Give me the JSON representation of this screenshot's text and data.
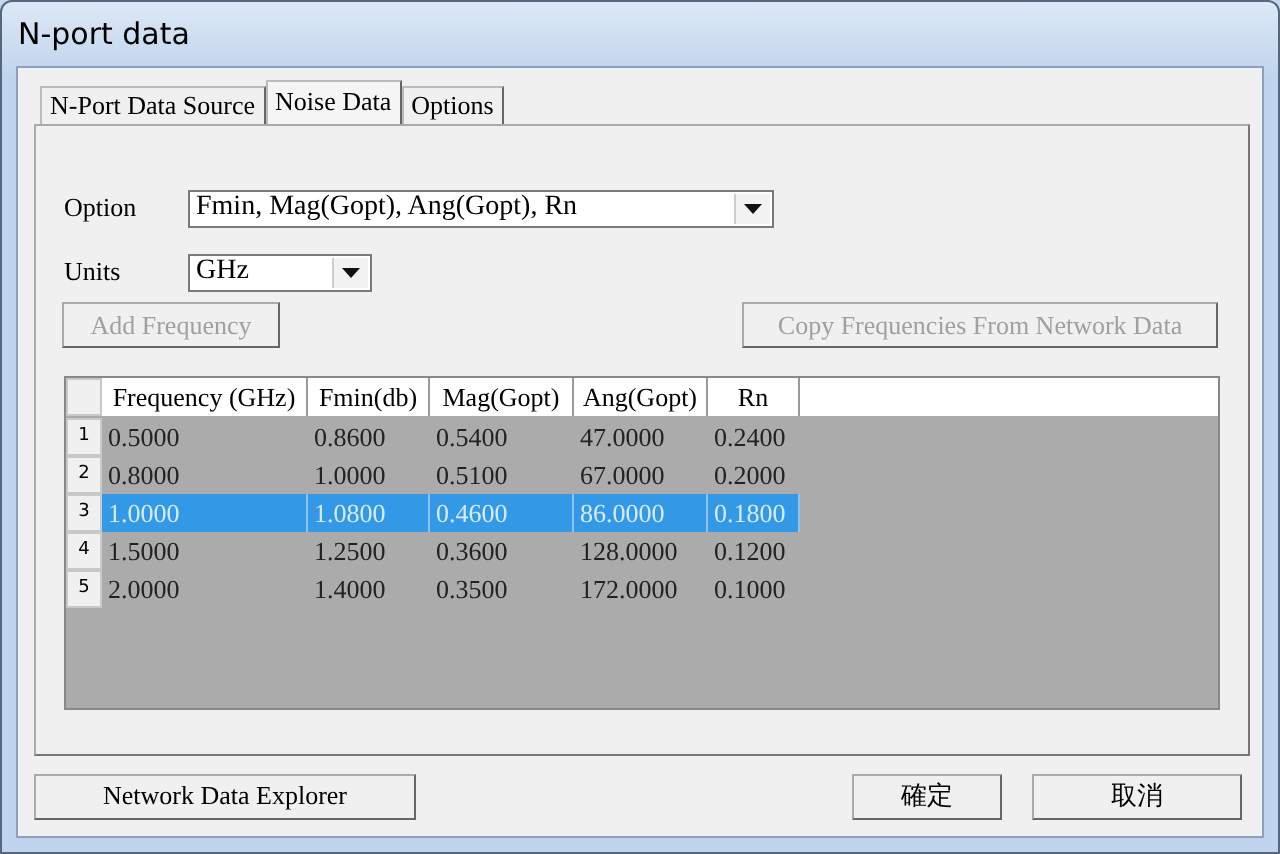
{
  "window": {
    "title": "N-port data"
  },
  "tabs": [
    {
      "label": "N-Port Data Source",
      "selected": false
    },
    {
      "label": "Noise Data",
      "selected": true
    },
    {
      "label": "Options",
      "selected": false
    }
  ],
  "option": {
    "label": "Option",
    "value": "Fmin, Mag(Gopt), Ang(Gopt), Rn"
  },
  "units": {
    "label": "Units",
    "value": "GHz"
  },
  "buttons": [
    {
      "label": "Add Frequency",
      "disabled": true
    },
    {
      "label": "Copy Frequencies From Network Data",
      "disabled": true
    }
  ],
  "table": {
    "columns": [
      "Frequency (GHz)",
      "Fmin(db)",
      "Mag(Gopt)",
      "Ang(Gopt)",
      "Rn"
    ],
    "rows": [
      {
        "number": "1",
        "cells": [
          "0.5000",
          "0.8600",
          "0.5400",
          "47.0000",
          "0.2400"
        ],
        "selected": false
      },
      {
        "number": "2",
        "cells": [
          "0.8000",
          "1.0000",
          "0.5100",
          "67.0000",
          "0.2000"
        ],
        "selected": false
      },
      {
        "number": "3",
        "cells": [
          "1.0000",
          "1.0800",
          "0.4600",
          "86.0000",
          "0.1800"
        ],
        "selected": true
      },
      {
        "number": "4",
        "cells": [
          "1.5000",
          "1.2500",
          "0.3600",
          "128.0000",
          "0.1200"
        ],
        "selected": false
      },
      {
        "number": "5",
        "cells": [
          "2.0000",
          "1.4000",
          "0.3500",
          "172.0000",
          "0.1000"
        ],
        "selected": false
      }
    ]
  },
  "footer_buttons": [
    {
      "label": "Network Data Explorer"
    },
    {
      "label": "確定"
    },
    {
      "label": "取消"
    }
  ]
}
